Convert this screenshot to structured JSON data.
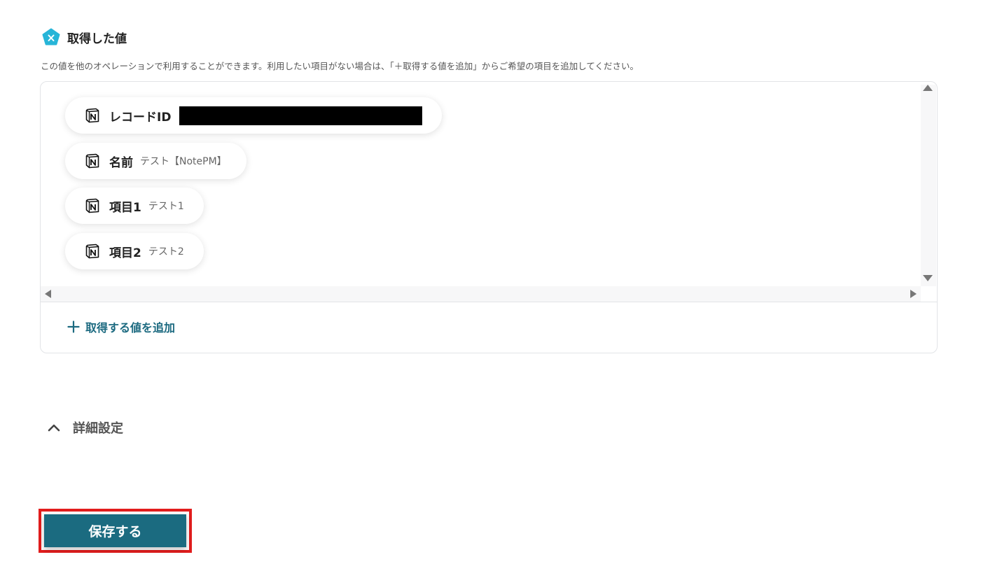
{
  "section": {
    "title": "取得した値",
    "description": "この値を他のオペレーションで利用することができます。利用したい項目がない場合は、「＋取得する値を追加」からご希望の項目を追加してください。"
  },
  "values": [
    {
      "label": "レコードID",
      "value": "",
      "redacted": true
    },
    {
      "label": "名前",
      "value": "テスト【NotePM】"
    },
    {
      "label": "項目1",
      "value": "テスト1"
    },
    {
      "label": "項目2",
      "value": "テスト2"
    }
  ],
  "add_button": {
    "label": "取得する値を追加"
  },
  "advanced": {
    "label": "詳細設定",
    "expanded": true
  },
  "save_button": {
    "label": "保存する"
  },
  "icons": {
    "section": "variable-pentagon-icon",
    "value": "notion-icon",
    "add": "plus-icon",
    "advanced": "chevron-up-icon"
  },
  "colors": {
    "accent": "#1b6b80",
    "section_icon": "#27b5d8",
    "highlight": "#e21d1d"
  }
}
